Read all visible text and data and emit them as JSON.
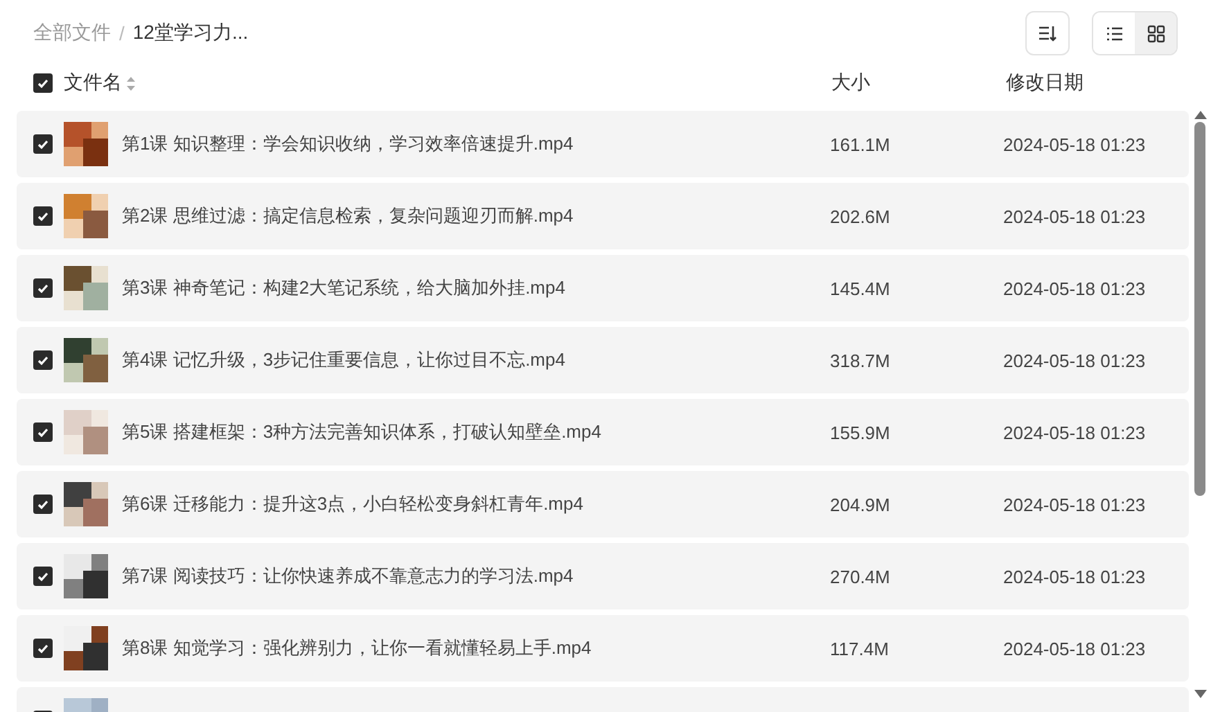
{
  "breadcrumb": [
    {
      "label": "全部文件",
      "current": false
    },
    {
      "separator": "/",
      "label": "12堂学习力...",
      "current": true
    }
  ],
  "view_toggle": [
    {
      "kind": "list",
      "selected": false
    },
    {
      "kind": "grid",
      "selected": true
    }
  ],
  "header": {
    "select_all": {
      "checked": true
    },
    "name": "文件名",
    "size": "大小",
    "date": "修改日期"
  },
  "files": [
    {
      "checked": true,
      "name": "第1课 知识整理：学会知识收纳，学习效率倍速提升.mp4",
      "size": "161.1M",
      "date": "2024-05-18 01:23"
    },
    {
      "checked": true,
      "name": "第2课 思维过滤：搞定信息检索，复杂问题迎刃而解.mp4",
      "size": "202.6M",
      "date": "2024-05-18 01:23"
    },
    {
      "checked": true,
      "name": "第3课 神奇笔记：构建2大笔记系统，给大脑加外挂.mp4",
      "size": "145.4M",
      "date": "2024-05-18 01:23"
    },
    {
      "checked": true,
      "name": "第4课 记忆升级，3步记住重要信息，让你过目不忘.mp4",
      "size": "318.7M",
      "date": "2024-05-18 01:23"
    },
    {
      "checked": true,
      "name": "第5课 搭建框架：3种方法完善知识体系，打破认知壁垒.mp4",
      "size": "155.9M",
      "date": "2024-05-18 01:23"
    },
    {
      "checked": true,
      "name": "第6课 迁移能力：提升这3点，小白轻松变身斜杠青年.mp4",
      "size": "204.9M",
      "date": "2024-05-18 01:23"
    },
    {
      "checked": true,
      "name": "第7课 阅读技巧：让你快速养成不靠意志力的学习法.mp4",
      "size": "270.4M",
      "date": "2024-05-18 01:23"
    },
    {
      "checked": true,
      "name": "第8课 知觉学习：强化辨别力，让你一看就懂轻易上手.mp4",
      "size": "117.4M",
      "date": "2024-05-18 01:23"
    },
    {
      "checked": true
    }
  ]
}
